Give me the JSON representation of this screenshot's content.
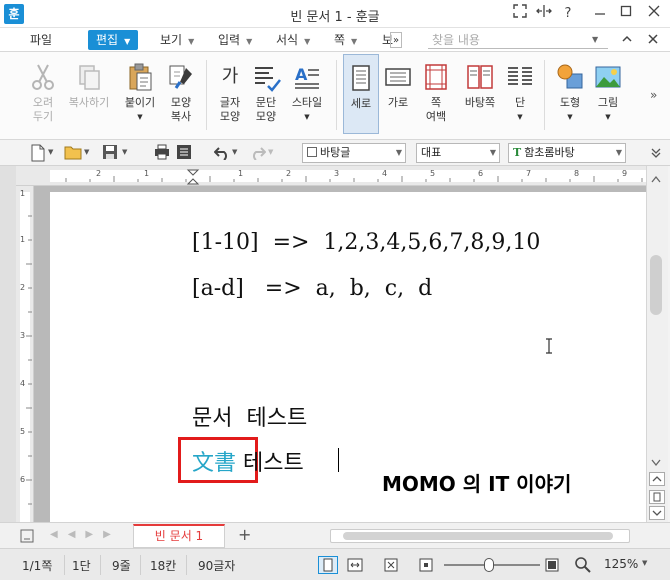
{
  "window": {
    "app_icon": "훈",
    "title": "빈 문서 1 - 훈글",
    "controls": {
      "help": "?"
    }
  },
  "menu": {
    "items": [
      {
        "label": "파일",
        "dropdown": false
      },
      {
        "label": "편집",
        "dropdown": true,
        "active": true
      },
      {
        "label": "보기",
        "dropdown": true
      },
      {
        "label": "입력",
        "dropdown": true
      },
      {
        "label": "서식",
        "dropdown": true
      },
      {
        "label": "쪽",
        "dropdown": true
      },
      {
        "label": "보",
        "dropdown": false
      }
    ],
    "overflow": "»",
    "search_placeholder": "찾을 내용"
  },
  "ribbon": {
    "cut": {
      "label": "오려\n두기",
      "icon": "scissors-icon"
    },
    "copy": {
      "label": "복사하기",
      "icon": "copy-icon"
    },
    "paste": {
      "label": "붙이기",
      "icon": "paste-icon"
    },
    "format_copy": {
      "label": "모양\n복사",
      "icon": "format-painter-icon"
    },
    "char_shape": {
      "label": "글자\n모양",
      "icon": "char-shape-icon",
      "glyph": "가"
    },
    "para_shape": {
      "label": "문단\n모양",
      "icon": "para-shape-icon"
    },
    "style": {
      "label": "스타일",
      "icon": "style-icon"
    },
    "vertical": {
      "label": "세로",
      "icon": "portrait-page-icon"
    },
    "horizontal": {
      "label": "가로",
      "icon": "landscape-page-icon"
    },
    "margin": {
      "label": "쪽\n여백",
      "icon": "page-margin-icon"
    },
    "bg_page": {
      "label": "바탕쪽",
      "icon": "master-page-icon"
    },
    "columns": {
      "label": "단",
      "icon": "columns-icon"
    },
    "shape": {
      "label": "도형",
      "icon": "shape-icon"
    },
    "picture": {
      "label": "그림",
      "icon": "picture-icon"
    }
  },
  "toolbar": {
    "style_combo": "바탕글",
    "language_combo": "대표",
    "font_combo": "함초롬바탕",
    "font_icon_glyph": "T"
  },
  "document": {
    "line1": "[1-10]  =>  1,2,3,4,5,6,7,8,9,10",
    "line2": "[a-d]   =>  a,  b,  c,  d",
    "line3": "문서  테스트",
    "line4_hanja": "文書",
    "line4_rest": " 테스트",
    "watermark": "MOMO 의 IT 이야기"
  },
  "tabs": {
    "doc_tab": "빈 문서 1",
    "add": "+"
  },
  "status": {
    "page": "1/1쪽",
    "column": "1단",
    "line": "9줄",
    "col": "18칸",
    "chars": "90글자",
    "zoom": "125%"
  },
  "colors": {
    "accent": "#1a8fd6",
    "hanja": "#26a6c8",
    "highlight_box": "#e21b1b",
    "tab_red": "#e53b3b"
  }
}
